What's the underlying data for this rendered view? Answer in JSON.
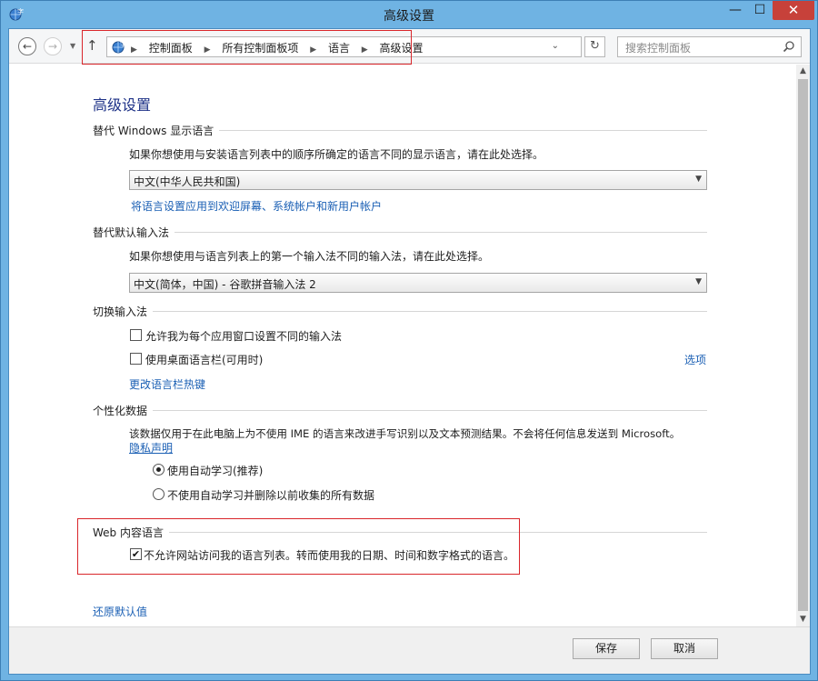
{
  "window": {
    "title": "高级设置",
    "minimize_glyph": "—",
    "maximize_glyph": "☐",
    "close_glyph": "✕"
  },
  "nav": {
    "back_glyph": "←",
    "forward_glyph": "→",
    "dropdown_glyph": "▼",
    "up_glyph": "↑",
    "breadcrumbs": [
      "控制面板",
      "所有控制面板项",
      "语言",
      "高级设置"
    ],
    "breadcrumb_separator": "▶",
    "address_dropdown_glyph": "⌄",
    "refresh_glyph": "↻",
    "search_placeholder": "搜索控制面板"
  },
  "page": {
    "title": "高级设置",
    "display_language": {
      "heading": "替代 Windows 显示语言",
      "description": "如果你想使用与安装语言列表中的顺序所确定的语言不同的显示语言，请在此处选择。",
      "selected": "中文(中华人民共和国)",
      "apply_link": "将语言设置应用到欢迎屏幕、系统帐户和新用户帐户"
    },
    "input_method": {
      "heading": "替代默认输入法",
      "description": "如果你想使用与语言列表上的第一个输入法不同的输入法，请在此处选择。",
      "selected": "中文(简体，中国) - 谷歌拼音输入法 2"
    },
    "switch_input": {
      "heading": "切换输入法",
      "per_app_label": "允许我为每个应用窗口设置不同的输入法",
      "per_app_checked": false,
      "language_bar_label": "使用桌面语言栏(可用时)",
      "language_bar_checked": false,
      "options_link": "选项",
      "hotkeys_link": "更改语言栏热键"
    },
    "personalization": {
      "heading": "个性化数据",
      "description": "该数据仅用于在此电脑上为不使用 IME 的语言来改进手写识别以及文本预测结果。不会将任何信息发送到 Microsoft。",
      "privacy_link": "隐私声明",
      "option_auto": "使用自动学习(推荐)",
      "option_no_auto": "不使用自动学习并删除以前收集的所有数据",
      "selected_option": "auto"
    },
    "web_language": {
      "heading": "Web 内容语言",
      "checkbox_label": "不允许网站访问我的语言列表。转而使用我的日期、时间和数字格式的语言。",
      "checked": true,
      "check_glyph": "✔"
    },
    "restore_link": "还原默认值"
  },
  "scrollbar": {
    "up_glyph": "▲",
    "down_glyph": "▼"
  },
  "footer": {
    "save_label": "保存",
    "cancel_label": "取消"
  },
  "colors": {
    "link": "#1a5fb4",
    "title": "#1e3287",
    "highlight_box": "#d9262b",
    "close_button": "#c7413a"
  }
}
